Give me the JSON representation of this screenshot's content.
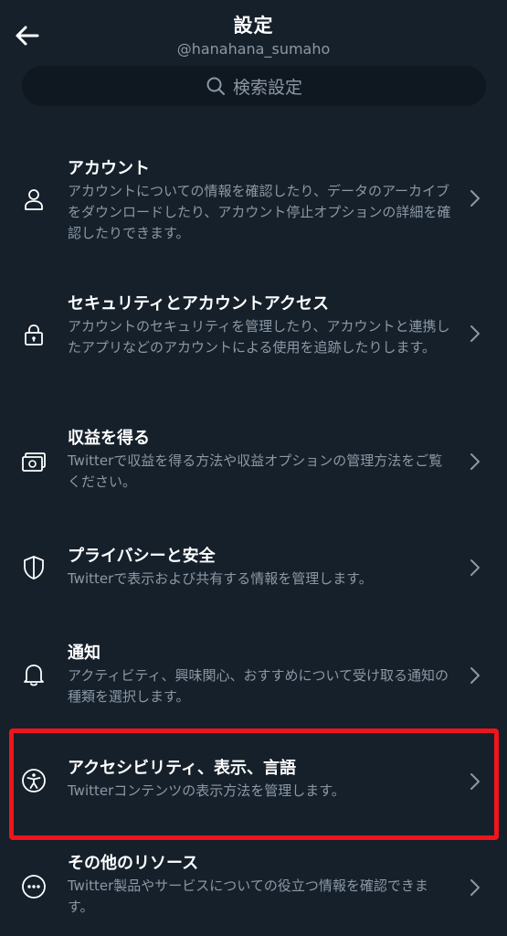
{
  "header": {
    "title": "設定",
    "handle": "@hanahana_sumaho",
    "back_icon": "arrow-left-icon"
  },
  "search": {
    "placeholder": "検索設定",
    "icon": "search-icon"
  },
  "items": [
    {
      "icon": "person-icon",
      "label": "アカウント",
      "desc": "アカウントについての情報を確認したり、データのアーカイブをダウンロードしたり、アカウント停止オプションの詳細を確認したりできます。"
    },
    {
      "icon": "lock-icon",
      "label": "セキュリティとアカウントアクセス",
      "desc": "アカウントのセキュリティを管理したり、アカウントと連携したアプリなどのアカウントによる使用を追跡したりします。"
    },
    {
      "icon": "money-icon",
      "label": "収益を得る",
      "desc": "Twitterで収益を得る方法や収益オプションの管理方法をご覧ください。"
    },
    {
      "icon": "shield-icon",
      "label": "プライバシーと安全",
      "desc": "Twitterで表示および共有する情報を管理します。"
    },
    {
      "icon": "bell-icon",
      "label": "通知",
      "desc": "アクティビティ、興味関心、おすすめについて受け取る通知の種類を選択します。"
    },
    {
      "icon": "accessibility-icon",
      "label": "アクセシビリティ、表示、言語",
      "desc": "Twitterコンテンツの表示方法を管理します。"
    },
    {
      "icon": "more-icon",
      "label": "その他のリソース",
      "desc": "Twitter製品やサービスについての役立つ情報を確認できます。"
    }
  ],
  "colors": {
    "background": "#15202b",
    "secondary_text": "#8b98a5",
    "highlight": "#f0141c"
  }
}
